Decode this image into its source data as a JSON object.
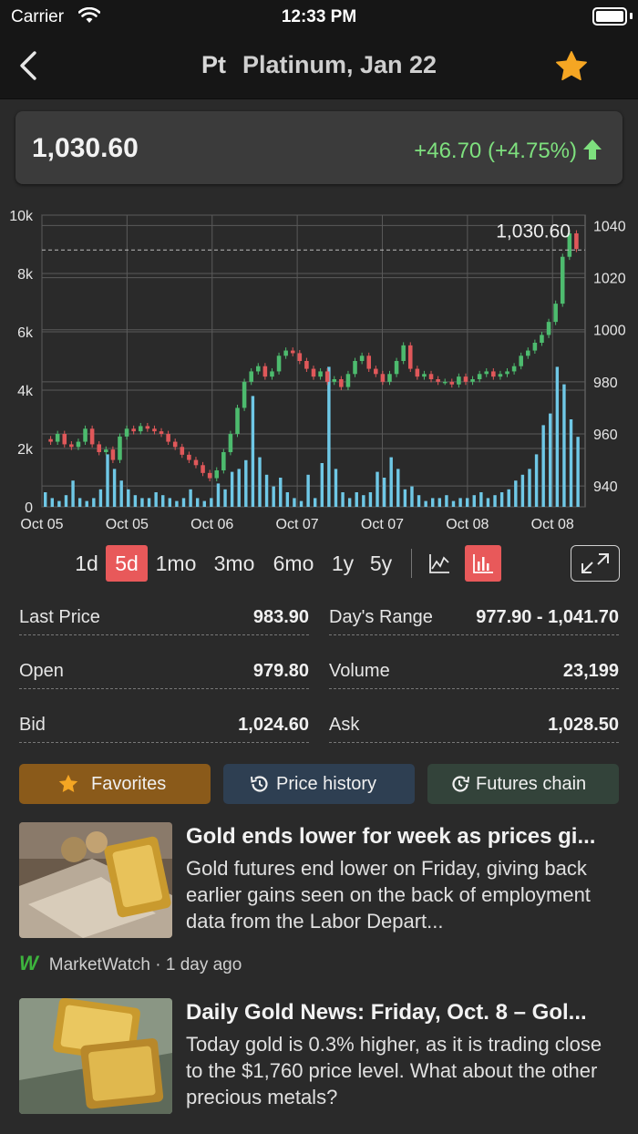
{
  "status": {
    "carrier": "Carrier",
    "time": "12:33 PM"
  },
  "nav": {
    "symbol": "Pt",
    "title": "Platinum, Jan 22"
  },
  "price": {
    "last": "1,030.60",
    "change": "+46.70 (+4.75%)"
  },
  "chart_data": {
    "type": "candlestick",
    "x_ticks": [
      "Oct 05",
      "Oct 05",
      "Oct 06",
      "Oct 07",
      "Oct 07",
      "Oct 08",
      "Oct 08"
    ],
    "left_y_ticks": [
      "0",
      "2k",
      "4k",
      "6k",
      "8k",
      "10k"
    ],
    "right_y_ticks": [
      "940",
      "960",
      "980",
      "1000",
      "1020",
      "1040"
    ],
    "volume_ylim": [
      0,
      10000
    ],
    "price_ylim": [
      932,
      1044
    ],
    "last_label": "1,030.60",
    "last_value": 1030.6,
    "price_series": [
      958,
      957,
      960,
      956,
      955,
      957,
      962,
      956,
      953,
      954,
      950,
      959,
      962,
      961,
      963,
      962,
      961,
      960,
      957,
      955,
      952,
      950,
      948,
      945,
      943,
      946,
      953,
      960,
      970,
      980,
      984,
      986,
      982,
      984,
      990,
      992,
      991,
      988,
      985,
      982,
      984,
      980,
      981,
      978,
      983,
      988,
      990,
      985,
      983,
      980,
      983,
      988,
      994,
      985,
      982,
      983,
      981,
      980,
      980,
      979,
      982,
      980,
      981,
      983,
      984,
      982,
      983,
      984,
      986,
      990,
      992,
      995,
      998,
      1003,
      1010,
      1028,
      1037,
      1031
    ],
    "volume_series": [
      500,
      300,
      200,
      400,
      900,
      300,
      200,
      300,
      600,
      1800,
      1300,
      900,
      600,
      400,
      300,
      300,
      500,
      400,
      300,
      200,
      300,
      600,
      300,
      200,
      300,
      800,
      600,
      1200,
      1300,
      1600,
      3800,
      1700,
      1100,
      700,
      1000,
      500,
      300,
      200,
      1100,
      300,
      1500,
      4800,
      1300,
      500,
      300,
      500,
      400,
      500,
      1200,
      1000,
      1700,
      1300,
      600,
      700,
      400,
      200,
      300,
      300,
      400,
      200,
      300,
      300,
      400,
      500,
      300,
      400,
      500,
      600,
      900,
      1100,
      1300,
      1800,
      2800,
      3200,
      4800,
      4200,
      3000,
      2400
    ]
  },
  "ranges": [
    "1d",
    "5d",
    "1mo",
    "3mo",
    "6mo",
    "1y",
    "5y"
  ],
  "active_range": "5d",
  "chart_types": [
    "line-chart-icon",
    "bar-chart-icon"
  ],
  "stats": {
    "last_price": {
      "label": "Last Price",
      "value": "983.90"
    },
    "days_range": {
      "label": "Day's Range",
      "value": "977.90 - 1,041.70"
    },
    "open": {
      "label": "Open",
      "value": "979.80"
    },
    "volume": {
      "label": "Volume",
      "value": "23,199"
    },
    "bid": {
      "label": "Bid",
      "value": "1,024.60"
    },
    "ask": {
      "label": "Ask",
      "value": "1,028.50"
    }
  },
  "buttons": {
    "favorites": "Favorites",
    "price_history": "Price history",
    "futures_chain": "Futures chain"
  },
  "news": [
    {
      "title": "Gold ends lower for week as prices gi...",
      "body": "Gold futures end lower on Friday, giving back earlier gains seen on the back of employment data from the Labor Depart...",
      "source": "MarketWatch · 1 day ago",
      "source_logo": "W"
    },
    {
      "title": "Daily Gold News: Friday, Oct. 8 – Gol...",
      "body": "Today gold is 0.3% higher, as it is trading close to the $1,760 price level. What about the other precious metals?"
    }
  ],
  "colors": {
    "accent": "#e8595a",
    "up": "#7ee07e",
    "star": "#f5a623",
    "candle_up": "#4dbb6e",
    "candle_down": "#e0585a",
    "volume": "#6fc8e6",
    "favorites_bg": "#8a5a1a",
    "price_history_bg": "#2e3f52",
    "futures_chain_bg": "#33433a"
  }
}
